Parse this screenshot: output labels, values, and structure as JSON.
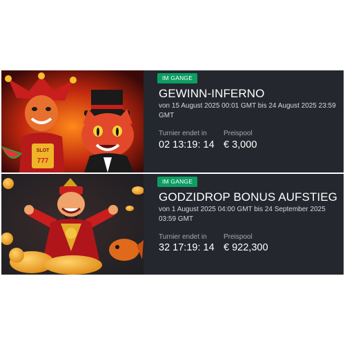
{
  "tournaments": [
    {
      "status": "IM GANGE",
      "title": "GEWINN-INFERNO",
      "dates": "von 15 August 2025 00:01 GMT bis 24 August 2025 23:59 GMT",
      "ends_label": "Turnier endet in",
      "ends_value": "02 13:19: 14",
      "prize_label": "Preispool",
      "prize_value": "€ 3,000",
      "art_text": "SLOT 777"
    },
    {
      "status": "IM GANGE",
      "title": "GODZIDROP BONUS AUFSTIEG",
      "dates": "von 1 August 2025 04:00 GMT bis 24 September 2025 03:59 GMT",
      "ends_label": "Turnier endet in",
      "ends_value": "32 17:19: 14",
      "prize_label": "Preispool",
      "prize_value": "€ 922,300"
    }
  ],
  "colors": {
    "card_bg": "#24272d",
    "badge_bg": "#0c9d63",
    "label": "#a6aab1"
  }
}
